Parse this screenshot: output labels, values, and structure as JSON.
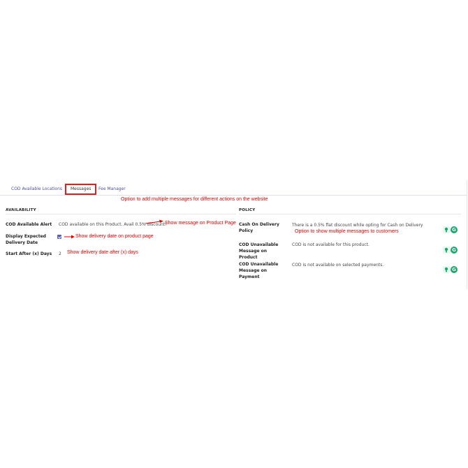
{
  "tabs": [
    {
      "label": "COD Available Locations"
    },
    {
      "label": "Messages"
    },
    {
      "label": "Fee Manager"
    }
  ],
  "annotations": {
    "top": "Option to add multiple messages for different actions on the website",
    "product_page": "Show message on Product Page",
    "delivery_date": "Show delivery date on product page",
    "after_days": "Show delivery date after (x) days",
    "customers": "Option to show multiple messages to customers"
  },
  "availability": {
    "heading": "AVAILABILITY",
    "alert_label": "COD Available Alert",
    "alert_value": "COD available on this Product. Avail 0.5% discount!",
    "display_label": "Display Expected Delivery Date",
    "display_checked": true,
    "start_label": "Start After (x) Days",
    "start_value": "2"
  },
  "policy": {
    "heading": "POLICY",
    "items": [
      {
        "label": "Cash On Delivery Policy",
        "value": "There is a 0.5% flat discount while opting for Cash on Delivery"
      },
      {
        "label": "COD Unavailable Message on Product",
        "value": "COD is not available for this product."
      },
      {
        "label": "COD Unavailable Message on Payment",
        "value": "COD is not available on selected payments."
      }
    ]
  },
  "icons": [
    "lightbulb-icon",
    "grammarly-icon"
  ],
  "colors": {
    "annotation": "#e00000",
    "tab_highlight": "#e01e1e",
    "checkbox": "#5a5fb0",
    "grammarly": "#17a86b"
  }
}
